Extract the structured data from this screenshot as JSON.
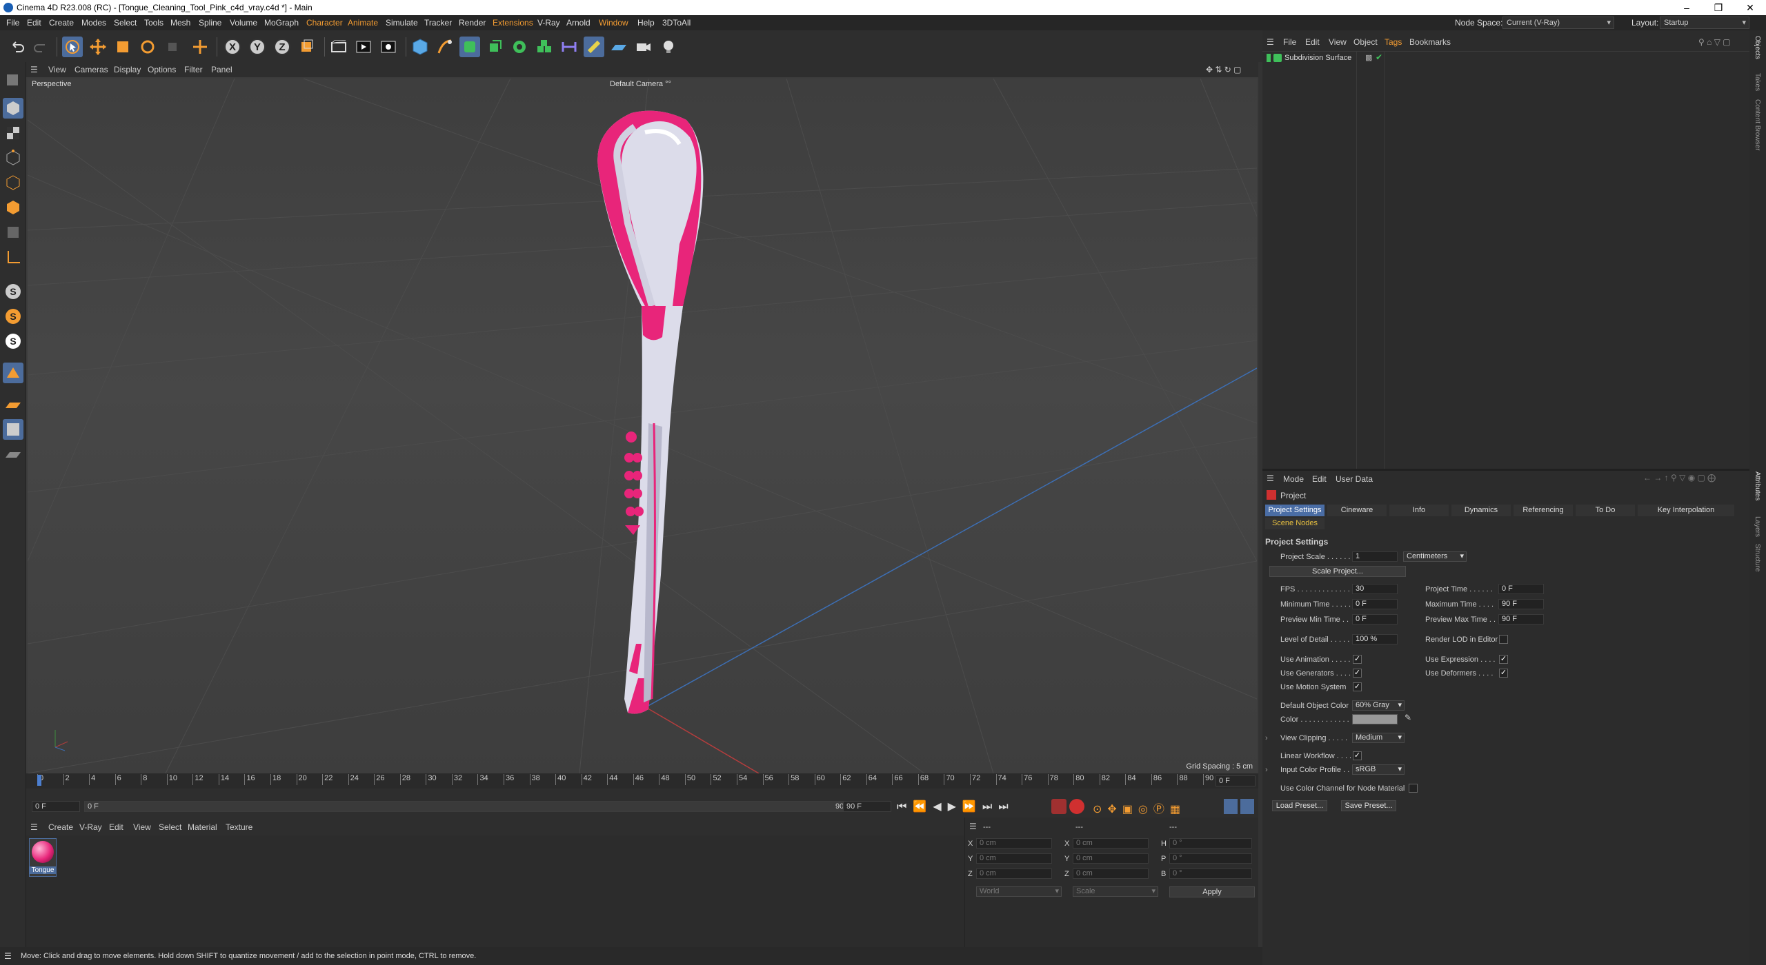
{
  "window": {
    "title": "Cinema 4D R23.008 (RC) - [Tongue_Cleaning_Tool_Pink_c4d_vray.c4d *] - Main"
  },
  "menubar": {
    "items": [
      "File",
      "Edit",
      "Create",
      "Modes",
      "Select",
      "Tools",
      "Mesh",
      "Spline",
      "Volume",
      "MoGraph",
      "Character",
      "Animate",
      "Simulate",
      "Tracker",
      "Render",
      "Extensions",
      "V-Ray",
      "Arnold",
      "Window",
      "Help",
      "3DToAll"
    ],
    "node_space_label": "Node Space:",
    "node_space_value": "Current (V-Ray)",
    "layout_label": "Layout:",
    "layout_value": "Startup"
  },
  "viewport": {
    "menu": [
      "View",
      "Cameras",
      "Display",
      "Options",
      "Filter",
      "Panel"
    ],
    "label": "Perspective",
    "camera": "Default Camera °°",
    "grid_spacing": "Grid Spacing : 5 cm"
  },
  "timeline": {
    "ticks": [
      "0",
      "2",
      "4",
      "6",
      "8",
      "10",
      "12",
      "14",
      "16",
      "18",
      "20",
      "22",
      "24",
      "26",
      "28",
      "30",
      "32",
      "34",
      "36",
      "38",
      "40",
      "42",
      "44",
      "46",
      "48",
      "50",
      "52",
      "54",
      "56",
      "58",
      "60",
      "62",
      "64",
      "66",
      "68",
      "70",
      "72",
      "74",
      "76",
      "78",
      "80",
      "82",
      "84",
      "86",
      "88",
      "90"
    ],
    "current_frame": "0 F",
    "end_field": "0 F",
    "start": "0 F",
    "range_start": "0 F",
    "range_end": "90 F",
    "max": "90 F"
  },
  "material_manager": {
    "menu": [
      "Create",
      "V-Ray",
      "Edit",
      "View",
      "Select",
      "Material",
      "Texture"
    ],
    "materials": [
      {
        "name": "Tongue"
      }
    ]
  },
  "coordinates": {
    "rows": [
      {
        "a": "X",
        "av": "0 cm",
        "b": "X",
        "bv": "0 cm",
        "c": "H",
        "cv": "0 °"
      },
      {
        "a": "Y",
        "av": "0 cm",
        "b": "Y",
        "bv": "0 cm",
        "c": "P",
        "cv": "0 °"
      },
      {
        "a": "Z",
        "av": "0 cm",
        "b": "Z",
        "bv": "0 cm",
        "c": "B",
        "cv": "0 °"
      }
    ],
    "mode": "World",
    "scale": "Scale",
    "apply": "Apply",
    "header1": "---",
    "header2": "---",
    "header3": "---"
  },
  "status": "Move: Click and drag to move elements. Hold down SHIFT to quantize movement / add to the selection in point mode, CTRL to remove.",
  "object_manager": {
    "menu": [
      "File",
      "Edit",
      "View",
      "Object",
      "Tags",
      "Bookmarks"
    ],
    "objects": [
      {
        "name": "Subdivision Surface"
      }
    ]
  },
  "attributes": {
    "menu": [
      "Mode",
      "Edit",
      "User Data"
    ],
    "object": "Project",
    "tabs": [
      "Project Settings",
      "Cineware",
      "Info",
      "Dynamics",
      "Referencing",
      "To Do",
      "Key Interpolation"
    ],
    "tab2": "Scene Nodes",
    "section": "Project Settings",
    "project_scale_label": "Project Scale . . . . . .",
    "project_scale_value": "1",
    "project_scale_unit": "Centimeters",
    "scale_project_btn": "Scale Project...",
    "fps_label": "FPS . . . . . . . . . . . . . .",
    "fps": "30",
    "project_time_label": "Project Time . . . . . .",
    "project_time": "0 F",
    "min_time_label": "Minimum Time . . . . .",
    "min_time": "0 F",
    "max_time_label": "Maximum Time . . . .",
    "max_time": "90 F",
    "prev_min_label": "Preview Min Time . .",
    "prev_min": "0 F",
    "prev_max_label": "Preview Max Time . .",
    "prev_max": "90 F",
    "lod_label": "Level of Detail . . . . .",
    "lod": "100 %",
    "render_lod_label": "Render LOD in Editor",
    "use_anim_label": "Use Animation . . . . .",
    "use_expr_label": "Use Expression . . . .",
    "use_gen_label": "Use Generators . . . .",
    "use_def_label": "Use Deformers . . . .",
    "use_motion_label": "Use Motion System",
    "def_color_label": "Default Object Color",
    "def_color": "60% Gray",
    "color_label": "Color . . . . . . . . . . . .",
    "color_swatch": "#999999",
    "view_clip_label": "View Clipping . . . . .",
    "view_clip": "Medium",
    "linear_label": "Linear Workflow . . . .",
    "input_profile_label": "Input Color Profile . .",
    "input_profile": "sRGB",
    "use_color_channel_label": "Use Color Channel for Node Material",
    "load_preset": "Load Preset...",
    "save_preset": "Save Preset..."
  },
  "right_strip": [
    "Objects",
    "Takes",
    "Content Browser",
    "Attributes",
    "Layers",
    "Structure"
  ]
}
